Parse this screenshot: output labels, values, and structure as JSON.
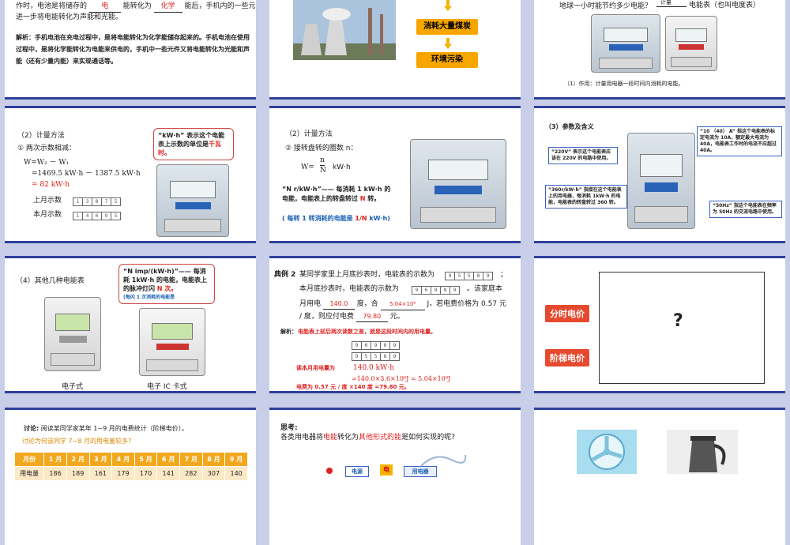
{
  "slide1": {
    "line1": "作时，电池是将储存的",
    "fill1": "电",
    "line1b": "能转化为",
    "fill2": "化学",
    "line1c": "能后，手机内的一些元件才能",
    "line2": "进一步将电能转化为声能和光能。",
    "analysis": "解析：手机电池在充电过程中，是将电能转化为化学能储存起来的。手机电池在使用过程中，是将化学能转化为电能来供电的，手机中一些元件又将电能转化为光能和声能（还有少量内能）来实现通话等。"
  },
  "slide2": {
    "box1": "消耗大量煤炭",
    "box2": "环境污染"
  },
  "slide3": {
    "question": "地球一小时能节约多少电能？",
    "arrow_label": "计量",
    "answer": "电能表（也叫电度表）",
    "note": "（1）作用：计量用电器一段时间内消耗的电能。"
  },
  "slide4": {
    "heading": "（2）计量方法",
    "item1": "① 两次示数相减：",
    "formula1": "W=W₂ － W₁",
    "formula2": "=1469.5 kW·h － 1387.5 kW·h",
    "formula3": "= 82  kW·h",
    "last_month": "上月示数",
    "this_month": "本月示数",
    "callout_a": "“kW·h” 表示这个电能表上示数的单位是",
    "callout_b": "千瓦时。",
    "digits_last": [
      "1",
      "3",
      "8",
      "7",
      "5"
    ],
    "digits_this": [
      "1",
      "4",
      "6",
      "9",
      "5"
    ]
  },
  "slide5": {
    "heading": "（2）计量方法",
    "item2": "② 接转盘转的圈数 n：",
    "formula": "W=",
    "frac_num": "n",
    "frac_den": "N",
    "unit": "kW·h",
    "callout_a": "“N r/kW·h”—— 每消耗 1 kW·h 的电能，电能表上的转盘转过",
    "callout_b": "N",
    "callout_c": "转。",
    "note": "( 每转 1 转消耗的电能是",
    "note_frac_num": "1",
    "note_frac_den": "N",
    "note_unit": "kW·h)"
  },
  "slide6": {
    "heading": "（3）参数及含义",
    "tag_10_40": "“10 （40） A” 指这个电能表的标定电流为 10A，额定最大电流为 40A，电能表工作时的电流不应超过 40A。",
    "tag_220v": "“220V” 表示这个电能表应该在 220V 的电路中使用。",
    "tag_360": "“360r/kW·h” 指接在这个电能表上的用电器，每消耗 1kW·h 的电能，电能表的转盘转过 360 转。",
    "tag_50hz": "“50Hz” 指这个电能表在频率为 50Hz 的交流电路中使用。"
  },
  "slide7": {
    "heading": "（4）其他几种电能表",
    "callout_a": "“N imp/(kW·h)”—— 每消耗 1kW·h 的电能，电能表上的脉冲灯闪",
    "callout_b": "N 次。",
    "callout_note": "(每闪 1 次消耗的电能是",
    "meter1": "电子式",
    "meter2": "电子 IC 卡式"
  },
  "slide8": {
    "label": "典例 2",
    "q1": "某同学家里上月底抄表时，电能表的示数为",
    "q1_end": "；",
    "q2": "本月底抄表时，电能表的示数为",
    "q2_end": "。该家庭本",
    "q3a": "月用电",
    "ans1": "140.0",
    "q3b": "度，合",
    "ans2": "5.04×10⁸",
    "q3c": "J，若电费价格为 0.57 元",
    "q4a": "/ 度，则应付电费",
    "ans3": "79.80",
    "q4b": "元。",
    "analysis_label": "解析：",
    "analysis": "电能表上前后两次读数之差，就是这段时间内的用电量。",
    "digits_a": [
      "9",
      "5",
      "5",
      "8",
      "9"
    ],
    "digits_b": [
      "9",
      "6",
      "9",
      "8",
      "9"
    ],
    "usage_label": "读本月用电量为",
    "usage_val": "140.0   kW·h",
    "usage_conv": "=140.0×3.6×10⁶J = 5.04×10⁸J",
    "fee": "电费为 0.57 元 / 度 ×140 度 =79.80 元。"
  },
  "slide9": {
    "tag1": "分时电价",
    "tag2": "阶梯电价",
    "mystery": "?"
  },
  "slide10": {
    "discuss_label": "讨论:",
    "discuss_text": "阅读某同学家某年 1~9 月的电费统计（阶梯电价）。",
    "question": "讨论为何该同学 7~8 月的用电量较多?",
    "headers": [
      "月份",
      "1 月",
      "2 月",
      "3 月",
      "4 月",
      "5 月",
      "6 月",
      "7 月",
      "8 月",
      "9 月"
    ],
    "row_label": "用电量",
    "values": [
      "186",
      "189",
      "161",
      "179",
      "170",
      "141",
      "282",
      "307",
      "140"
    ]
  },
  "slide11": {
    "think_label": "思考:",
    "think_a": "各类用电器将",
    "think_b": "电能",
    "think_c": "转化为",
    "think_d": "其他形式的能",
    "think_e": "是如何实现的呢?",
    "box1": "电源",
    "box2": "电",
    "box3": "用电器"
  }
}
